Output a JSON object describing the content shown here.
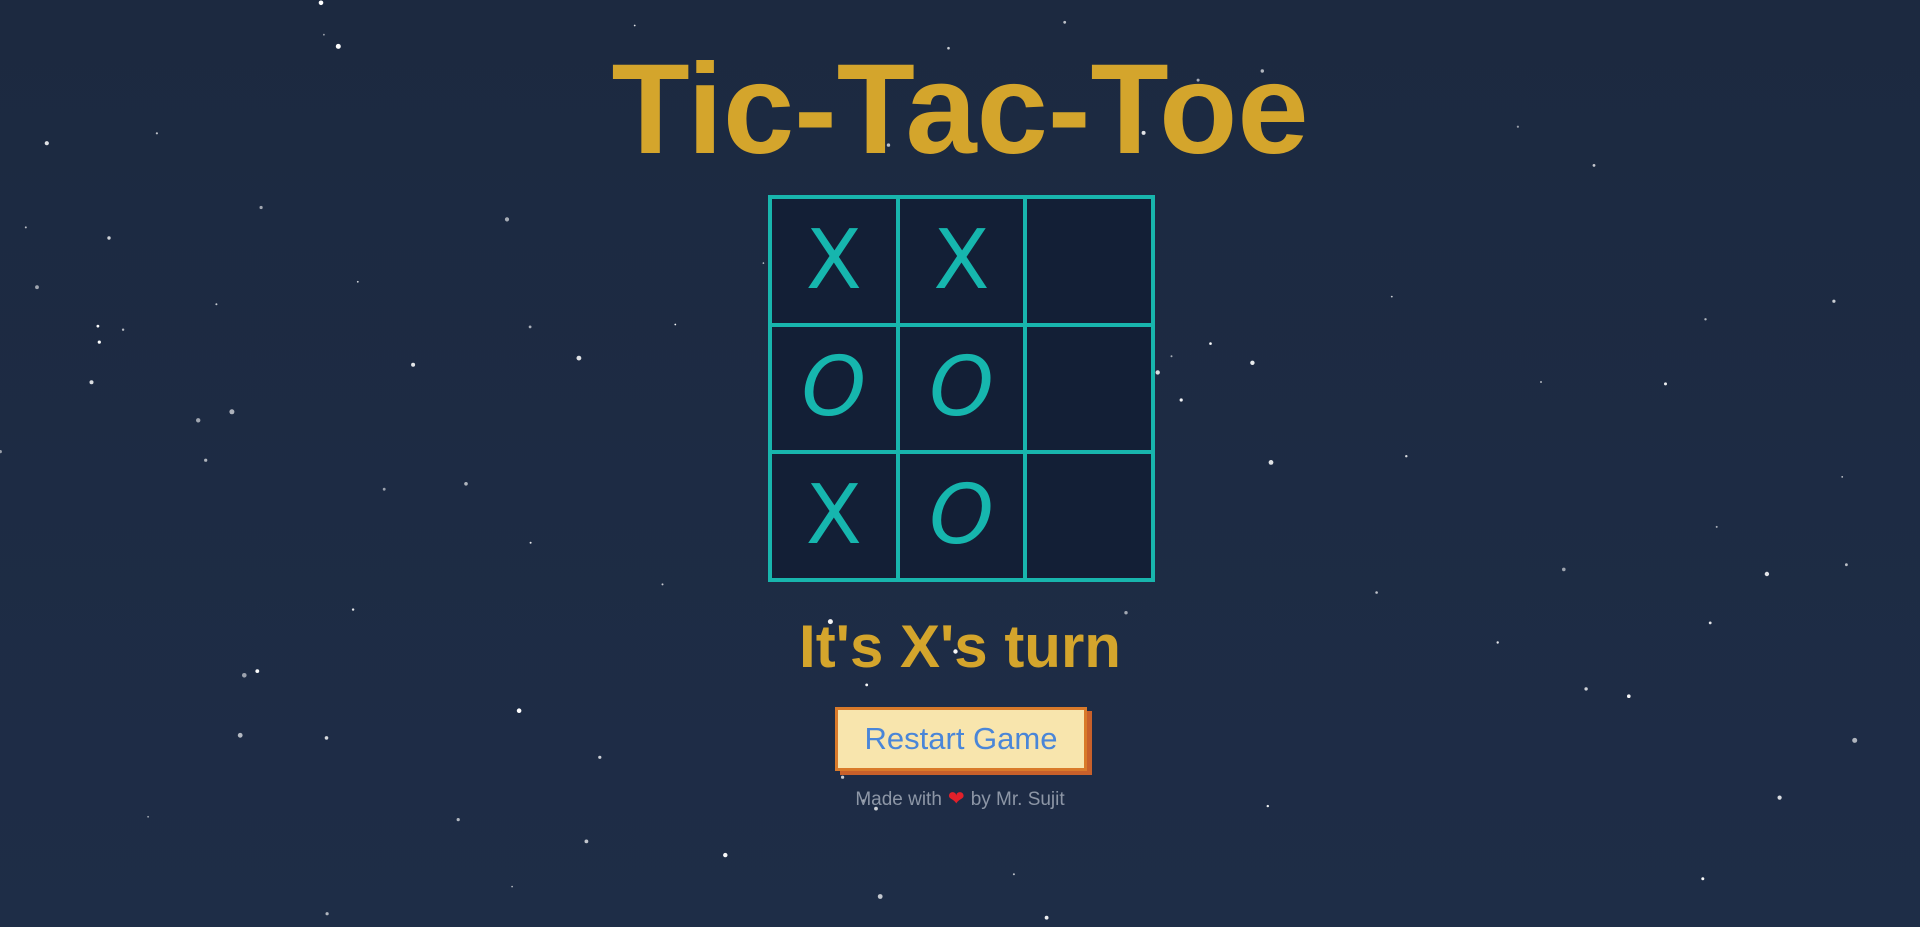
{
  "title": "Tic-Tac-Toe",
  "board": {
    "cells": [
      "X",
      "X",
      "",
      "O",
      "O",
      "",
      "X",
      "O",
      ""
    ]
  },
  "status": "It's X's turn",
  "restart_label": "Restart Game",
  "footer": {
    "prefix": "Made with",
    "suffix": "by Mr. Sujit",
    "icon": "heart-icon"
  },
  "colors": {
    "background": "#1d2b44",
    "accent_gold": "#d4a52c",
    "grid_teal": "#18b5ad",
    "button_bg": "#f8e5ad",
    "button_border": "#d97a2a",
    "button_text": "#4a86d8"
  }
}
